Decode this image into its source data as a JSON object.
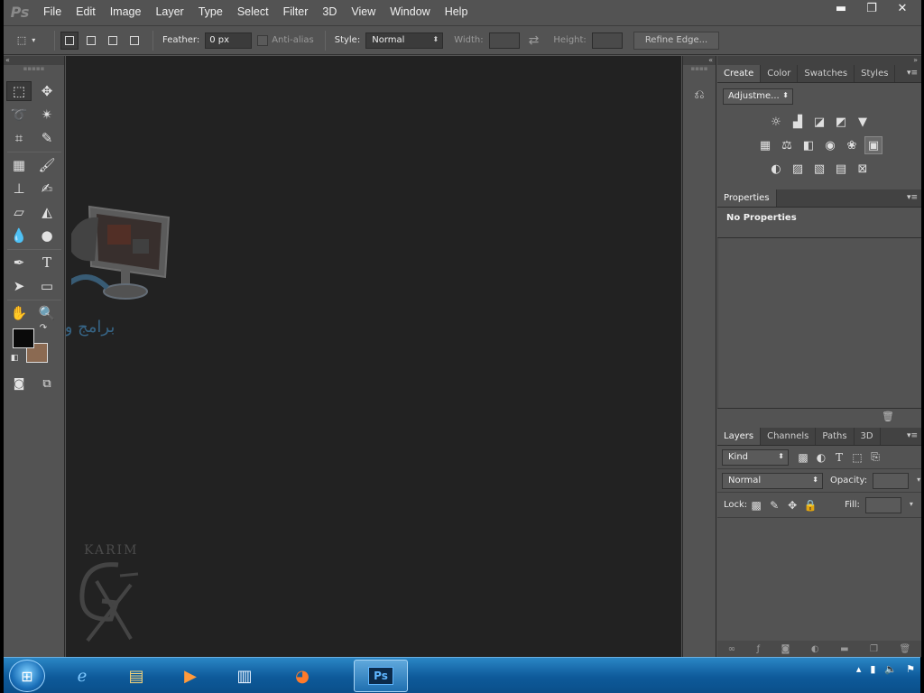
{
  "app": {
    "logo": "Ps"
  },
  "menu": [
    "File",
    "Edit",
    "Image",
    "Layer",
    "Type",
    "Select",
    "Filter",
    "3D",
    "View",
    "Window",
    "Help"
  ],
  "window_controls": {
    "minimize": "▬",
    "restore": "❐",
    "close": "✕"
  },
  "options": {
    "feather_label": "Feather:",
    "feather_value": "0 px",
    "antialias_label": "Anti-alias",
    "style_label": "Style:",
    "style_value": "Normal",
    "width_label": "Width:",
    "height_label": "Height:",
    "refine_label": "Refine Edge..."
  },
  "tools": [
    {
      "name": "rectangular-marquee-tool",
      "glyph": "⬚"
    },
    {
      "name": "move-tool",
      "glyph": "✥"
    },
    {
      "name": "lasso-tool",
      "glyph": "➰"
    },
    {
      "name": "magic-wand-tool",
      "glyph": "✴"
    },
    {
      "name": "crop-tool",
      "glyph": "⌗"
    },
    {
      "name": "eyedropper-tool",
      "glyph": "✎"
    },
    {
      "name": "healing-brush-tool",
      "glyph": "▦"
    },
    {
      "name": "brush-tool",
      "glyph": "🖌"
    },
    {
      "name": "clone-stamp-tool",
      "glyph": "⊥"
    },
    {
      "name": "history-brush-tool",
      "glyph": "✍"
    },
    {
      "name": "eraser-tool",
      "glyph": "▱"
    },
    {
      "name": "paint-bucket-tool",
      "glyph": "◭"
    },
    {
      "name": "blur-tool",
      "glyph": "💧"
    },
    {
      "name": "dodge-tool",
      "glyph": "●"
    },
    {
      "name": "pen-tool",
      "glyph": "✒"
    },
    {
      "name": "type-tool",
      "glyph": "T"
    },
    {
      "name": "path-selection-tool",
      "glyph": "➤"
    },
    {
      "name": "rectangle-tool",
      "glyph": "▭"
    },
    {
      "name": "hand-tool",
      "glyph": "✋"
    },
    {
      "name": "zoom-tool",
      "glyph": "🔍"
    }
  ],
  "colors": {
    "foreground": "#0a0a0a",
    "background": "#8b6a52",
    "canvas": "#222222",
    "panel": "#535353"
  },
  "watermark": {
    "arabic": "برامج وملحقات",
    "karim": "KARIM"
  },
  "adjust_panel": {
    "tabs": [
      "Create",
      "Color",
      "Swatches",
      "Styles"
    ],
    "dropdown": "Adjustme...",
    "rows": [
      [
        "brightness-icon",
        "levels-icon",
        "curves-icon",
        "exposure-icon",
        "vibrance-icon"
      ],
      [
        "hue-saturation-icon",
        "color-balance-icon",
        "black-white-icon",
        "photo-filter-icon",
        "channel-mixer-icon",
        "color-lookup-icon"
      ],
      [
        "invert-icon",
        "posterize-icon",
        "threshold-icon",
        "gradient-map-icon",
        "selective-color-icon"
      ]
    ]
  },
  "properties": {
    "tab": "Properties",
    "empty_text": "No Properties"
  },
  "layers": {
    "tabs": [
      "Layers",
      "Channels",
      "Paths",
      "3D"
    ],
    "kind_label": "Kind",
    "blend_mode": "Normal",
    "opacity_label": "Opacity:",
    "lock_label": "Lock:",
    "fill_label": "Fill:"
  },
  "taskbar": {
    "buttons": [
      "ie-icon",
      "explorer-icon",
      "media-player-icon",
      "app-icon",
      "firefox-icon",
      "photoshop-icon"
    ],
    "active": "photoshop-icon"
  }
}
